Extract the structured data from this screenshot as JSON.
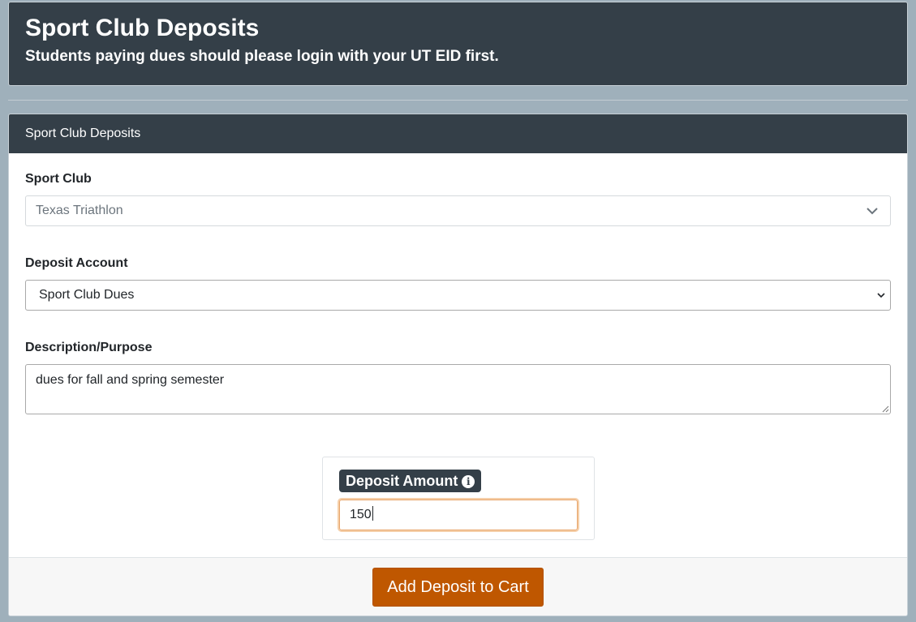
{
  "header": {
    "title": "Sport Club Deposits",
    "subtitle": "Students paying dues should please login with your UT EID first."
  },
  "card": {
    "title": "Sport Club Deposits"
  },
  "form": {
    "sport_club": {
      "label": "Sport Club",
      "selected": "Texas Triathlon"
    },
    "deposit_account": {
      "label": "Deposit Account",
      "selected": "Sport Club Dues"
    },
    "description": {
      "label": "Description/Purpose",
      "value": "dues for fall and spring semester"
    },
    "deposit_amount": {
      "label": "Deposit Amount",
      "value": "150",
      "info_icon": "info-circle-icon"
    }
  },
  "footer": {
    "submit_label": "Add Deposit to Cart"
  },
  "colors": {
    "header_bg": "#343f48",
    "page_bg": "#9fb0bb",
    "accent": "#bf5700",
    "focus_border": "#e8a56b"
  }
}
